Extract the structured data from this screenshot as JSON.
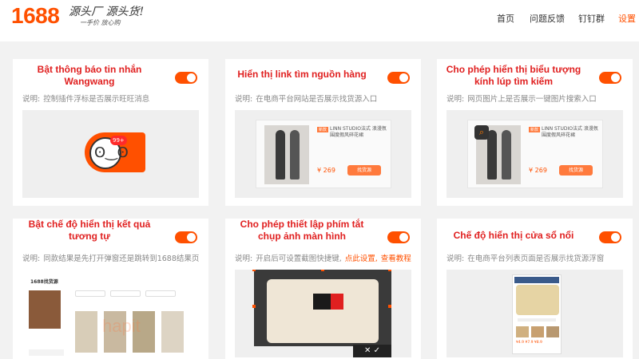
{
  "header": {
    "logo_number": "1688",
    "logo_slogan": "源头厂 源头货!",
    "logo_sub": "一手价 放心购",
    "nav": [
      {
        "label": "首页",
        "active": false
      },
      {
        "label": "问题反馈",
        "active": false
      },
      {
        "label": "钉钉群",
        "active": false
      },
      {
        "label": "设置",
        "active": true
      }
    ]
  },
  "desc_label": "说明:",
  "cards": [
    {
      "title": "Bật thông báo tin nhắn Wangwang",
      "enabled": true,
      "desc": "控制插件浮标是否展示旺旺消息",
      "badge": "99+"
    },
    {
      "title": "Hiển thị link tìm nguồn hàng",
      "enabled": true,
      "desc": "在电商平台网站是否展示找货源入口",
      "product": {
        "tag": "新款",
        "name": "LINN STUDIO法式 浪漫氛围度假风碎花裙",
        "price": "¥ 269",
        "button": "找货源"
      }
    },
    {
      "title": "Cho phép hiển thị biểu tượng kính lúp tìm kiếm",
      "enabled": true,
      "desc": "网页图片上是否展示一键图片搜索入口",
      "product": {
        "tag": "新款",
        "name": "LINN STUDIO法式 浪漫氛围度假风碎花裙",
        "price": "¥ 269",
        "button": "找货源"
      }
    },
    {
      "title": "Bật chế độ hiển thị kết quả tương tự",
      "enabled": true,
      "desc": "同款结果是先打开弹窗还是跳转到1688结果页",
      "brand": "1688找货源",
      "watermark": "hapit"
    },
    {
      "title": "Cho phép thiết lập phím tắt chụp ảnh màn hình",
      "enabled": true,
      "desc": "开启后可设置截图快捷键,",
      "link1": "点此设置,",
      "link2": "查看教程",
      "shot_actions": "✕  ✓"
    },
    {
      "title": "Chế độ hiển thị cửa sổ nổi",
      "enabled": true,
      "desc": "在电商平台列表页面是否展示找货源浮窗",
      "popup_price": "¥4.9 ¥7.9 ¥8.9"
    }
  ],
  "colors": {
    "accent": "#ff5000",
    "title_red": "#e02020"
  }
}
